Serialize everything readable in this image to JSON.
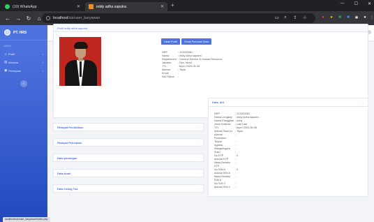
{
  "browser": {
    "tabs": [
      {
        "title": "(10) WhatsApp",
        "icon": "whatsapp-icon",
        "color": "#25d366"
      },
      {
        "title": "eddy adha saputra",
        "icon": "site-icon",
        "color": "#f28b20"
      }
    ],
    "url_host": "localhost",
    "url_path": "/sis/user_karyawan",
    "status_text": "localhost/sis/user_karyawan/index.php"
  },
  "app": {
    "brand": "PT. HRS",
    "sidebar_heading": "MENU",
    "sidebar": [
      {
        "label": "Profil",
        "icon": "user-icon"
      },
      {
        "label": "Absensi",
        "icon": "clipboard-icon"
      },
      {
        "label": "Pekerjaan",
        "icon": "briefcase-icon"
      }
    ],
    "topbar_user": "eddy adha saputra"
  },
  "profile": {
    "header": "Profil eddy adha saputra",
    "buttons": {
      "edit": "Ubah Profil",
      "print": "Cetak Personal Data"
    },
    "fields": [
      {
        "key": "NRP",
        "value": ": 123200081"
      },
      {
        "key": "Nama",
        "value": ": eddy adha saputra"
      },
      {
        "key": "Departemen",
        "value": ": General Service & Human Resource"
      },
      {
        "key": "Jabatan",
        "value": ": Dev. Head"
      },
      {
        "key": "TTL",
        "value": ": tepm 2020-05-08"
      },
      {
        "key": "Alamat",
        "value": ": Tepm"
      },
      {
        "key": "Email",
        "value": ":"
      },
      {
        "key": "Nel Telpon",
        "value": ":"
      }
    ]
  },
  "accordions": [
    "Riwayat Pendidikan",
    "Riwayat Pekerjaan",
    "Data pasangan",
    "Data Anak",
    "Data Orang Tua"
  ],
  "data_diri": {
    "title": "Data_diri",
    "fields": [
      {
        "key": "NRP",
        "value": ": 123200081"
      },
      {
        "key": "Nama Lengkap",
        "value": ": eddy adha saputra"
      },
      {
        "key": "Nama Panggilan",
        "value": ": eddy"
      },
      {
        "key": "Jenis Kelamin",
        "value": ": Laki Laki"
      },
      {
        "key": "TTL",
        "value": ": tepm 2020-05-08"
      },
      {
        "key": "Alamat Saat ini",
        "value": ": Tepm"
      },
      {
        "key": "Alamat Permanen",
        "value": ":"
      },
      {
        "key": "Telpon",
        "value": ":"
      },
      {
        "key": "Agama",
        "value": ":"
      },
      {
        "key": "Warganegara",
        "value": ":"
      },
      {
        "key": "Suku",
        "value": ":"
      },
      {
        "key": "No KTP",
        "value": ": 0"
      },
      {
        "key": "Alamat KTP",
        "value": ":"
      },
      {
        "key": "Masa Berlaku KTP",
        "value": ":"
      },
      {
        "key": "No SIM A",
        "value": ": 0"
      },
      {
        "key": "Alamat SIM A",
        "value": ":"
      },
      {
        "key": "Masa Berlaku SIM A",
        "value": ":"
      },
      {
        "key": "No SIM C",
        "value": ":"
      },
      {
        "key": "Alamat SIM C",
        "value": ":"
      }
    ]
  }
}
